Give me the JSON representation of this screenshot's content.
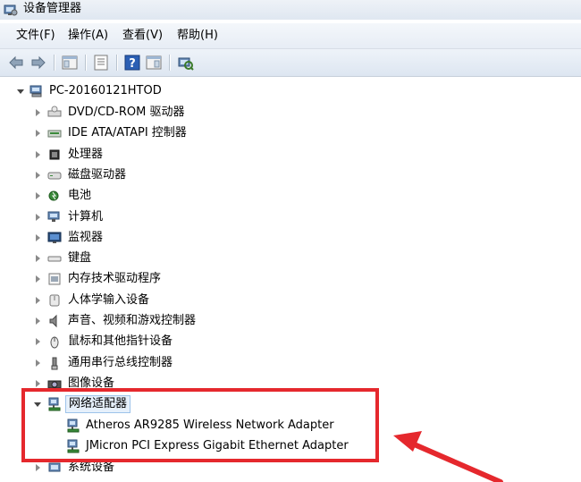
{
  "window": {
    "title": "设备管理器"
  },
  "menu": [
    {
      "label": "文件(F)"
    },
    {
      "label": "操作(A)"
    },
    {
      "label": "查看(V)"
    },
    {
      "label": "帮助(H)"
    }
  ],
  "toolbar": [
    {
      "icon": "back-arrow-icon"
    },
    {
      "icon": "forward-arrow-icon"
    },
    {
      "icon": "show-hide-console-tree-icon"
    },
    {
      "icon": "properties-icon"
    },
    {
      "icon": "help-icon"
    },
    {
      "icon": "action-pane-icon"
    },
    {
      "icon": "scan-hardware-changes-icon"
    }
  ],
  "tree": {
    "root": "PC-20160121HTOD",
    "categories": [
      {
        "label": "DVD/CD-ROM 驱动器",
        "icon": "dvd-drive-icon"
      },
      {
        "label": "IDE ATA/ATAPI 控制器",
        "icon": "ide-controller-icon"
      },
      {
        "label": "处理器",
        "icon": "processor-icon"
      },
      {
        "label": "磁盘驱动器",
        "icon": "disk-drive-icon"
      },
      {
        "label": "电池",
        "icon": "battery-icon"
      },
      {
        "label": "计算机",
        "icon": "computer-icon"
      },
      {
        "label": "监视器",
        "icon": "monitor-icon"
      },
      {
        "label": "键盘",
        "icon": "keyboard-icon"
      },
      {
        "label": "内存技术驱动程序",
        "icon": "memory-icon"
      },
      {
        "label": "人体学输入设备",
        "icon": "hid-icon"
      },
      {
        "label": "声音、视频和游戏控制器",
        "icon": "sound-icon"
      },
      {
        "label": "鼠标和其他指针设备",
        "icon": "mouse-icon"
      },
      {
        "label": "通用串行总线控制器",
        "icon": "usb-icon"
      },
      {
        "label": "图像设备",
        "icon": "camera-icon"
      }
    ],
    "network": {
      "label": "网络适配器",
      "icon": "network-adapter-icon",
      "children": [
        {
          "label": "Atheros AR9285 Wireless Network Adapter"
        },
        {
          "label": "JMicron PCI Express Gigabit Ethernet Adapter"
        }
      ]
    },
    "last": {
      "label": "系统设备",
      "icon": "system-device-icon"
    }
  },
  "annotation": {
    "box_color": "#e5282d",
    "arrow_color": "#e5282d"
  }
}
